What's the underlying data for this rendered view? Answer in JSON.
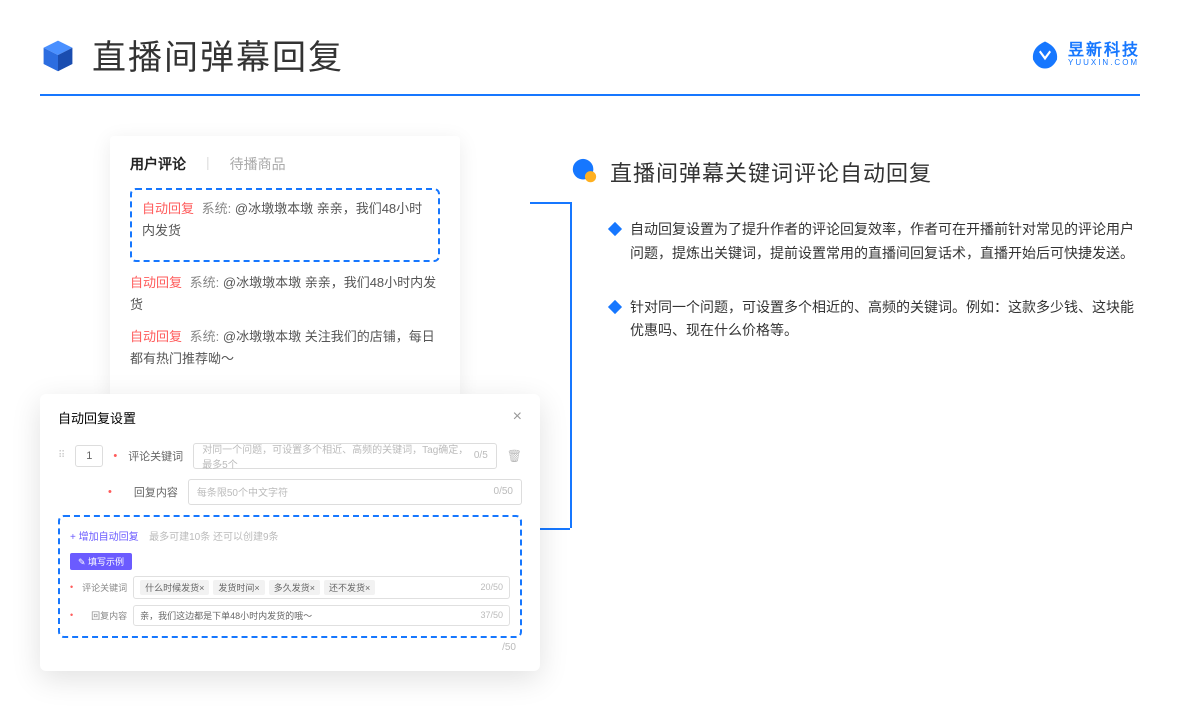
{
  "header": {
    "title": "直播间弹幕回复",
    "logo_main": "昱新科技",
    "logo_sub": "YUUXIN.COM"
  },
  "comments": {
    "tab_active": "用户评论",
    "tab_inactive": "待播商品",
    "items": [
      {
        "badge": "自动回复",
        "system": "系统:",
        "text": "@冰墩墩本墩 亲亲，我们48小时内发货"
      },
      {
        "badge": "自动回复",
        "system": "系统:",
        "text": "@冰墩墩本墩 亲亲，我们48小时内发货"
      },
      {
        "badge": "自动回复",
        "system": "系统:",
        "text": "@冰墩墩本墩 关注我们的店铺，每日都有热门推荐呦～"
      }
    ]
  },
  "settings": {
    "title": "自动回复设置",
    "index": "1",
    "keyword_label": "评论关键词",
    "keyword_placeholder": "对同一个问题，可设置多个相近、高频的关键词，Tag确定，最多5个",
    "keyword_count": "0/5",
    "content_label": "回复内容",
    "content_placeholder": "每条限50个中文字符",
    "content_count": "0/50",
    "add_label": "+ 增加自动回复",
    "add_hint": "最多可建10条 还可以创建9条",
    "example_badge": "✎ 填写示例",
    "ex_keyword_label": "评论关键词",
    "ex_tags": [
      "什么时候发货×",
      "发货时间×",
      "多久发货×",
      "还不发货×"
    ],
    "ex_keyword_count": "20/50",
    "ex_content_label": "回复内容",
    "ex_content_value": "亲，我们这边都是下单48小时内发货的哦～",
    "ex_content_count": "37/50",
    "outer_count": "/50"
  },
  "right": {
    "section_title": "直播间弹幕关键词评论自动回复",
    "bullets": [
      "自动回复设置为了提升作者的评论回复效率，作者可在开播前针对常见的评论用户问题，提炼出关键词，提前设置常用的直播间回复话术，直播开始后可快捷发送。",
      "针对同一个问题，可设置多个相近的、高频的关键词。例如：这款多少钱、这块能优惠吗、现在什么价格等。"
    ]
  }
}
